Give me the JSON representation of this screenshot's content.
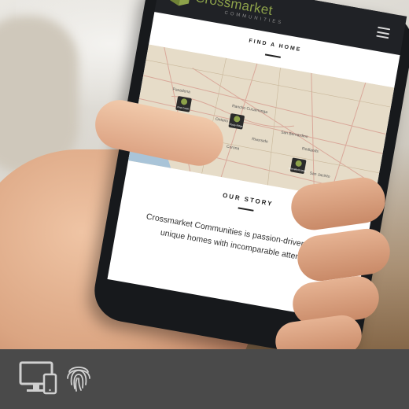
{
  "app": {
    "brand_name": "Crossmarket",
    "brand_sub": "COMMUNITIES",
    "brand_color": "#8da24a",
    "menu_icon": "hamburger-menu-icon"
  },
  "find_home": {
    "heading": "FIND A HOME"
  },
  "map": {
    "places": [
      "Pasadena",
      "Rancho Cucamonga",
      "Ontario",
      "San Bernardino",
      "Riverside",
      "Redlands",
      "Corona",
      "San Jacinto"
    ],
    "pins": [
      "Pine Creek",
      "Rocky Ridge",
      "Marvella Estates"
    ],
    "water_color": "#a9c4d8",
    "land_color": "#e6dcc8"
  },
  "our_story": {
    "heading": "OUR STORY",
    "text": "Crossmarket Communities is passion-driven to deliver unique homes with incomparable attention to"
  },
  "footer": {
    "icons": [
      "devices-icon",
      "fingerprint-icon"
    ]
  }
}
